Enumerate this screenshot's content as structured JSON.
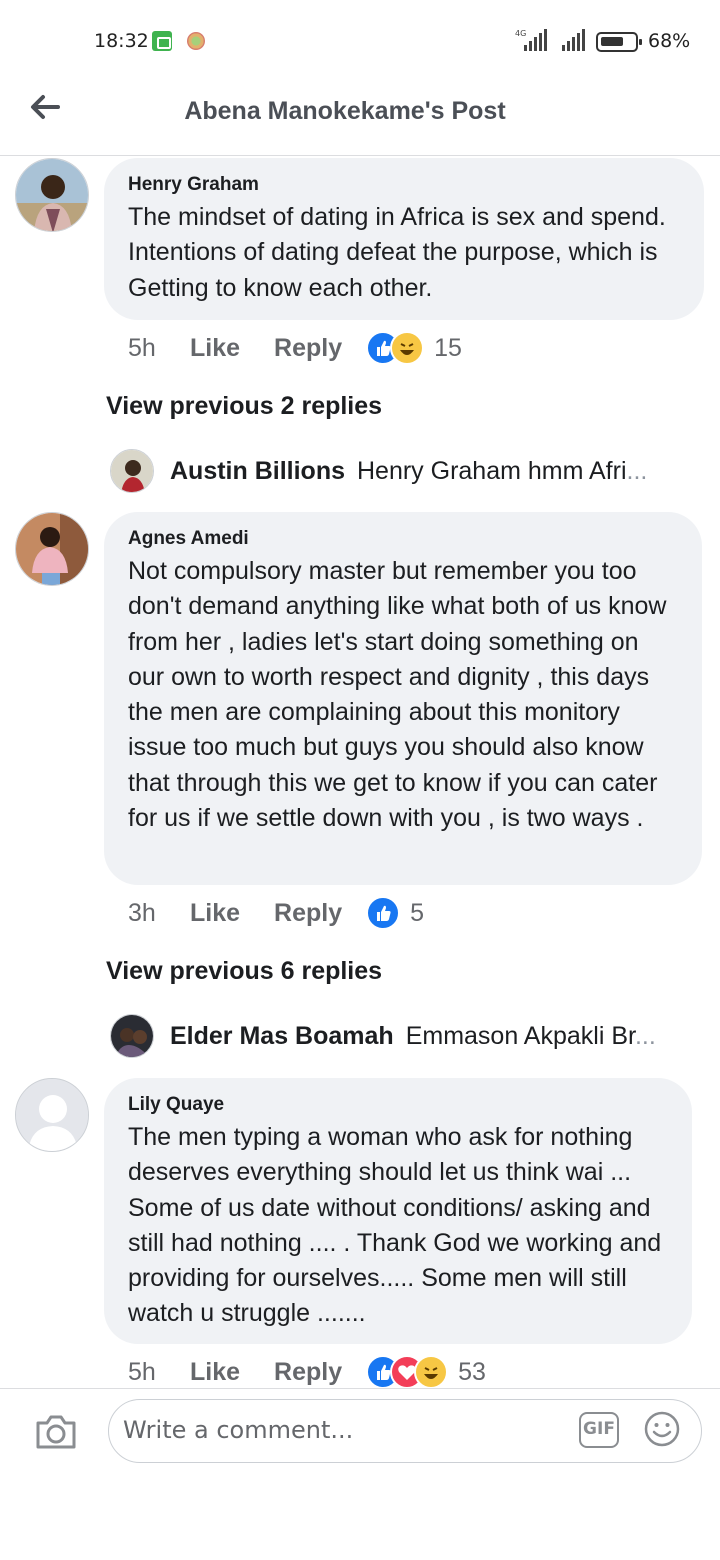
{
  "status_bar": {
    "time": "18:32",
    "network": "4G",
    "battery_pct": "68%",
    "battery_level": 0.68
  },
  "header": {
    "title": "Abena Manokekame's Post",
    "back_icon": "arrow-left-icon"
  },
  "comments": [
    {
      "name": "Henry Graham",
      "text": "The mindset of dating in Africa is sex and spend. Intentions of dating defeat the purpose, which is Getting to know each other.",
      "time": "5h",
      "like": "Like",
      "reply": "Reply",
      "reactions": [
        "like",
        "haha"
      ],
      "count": "15"
    },
    {
      "name": "Agnes Amedi",
      "text": "Not compulsory master but remember you too don't demand anything like what both of us know from her , ladies let's start doing something on our own to worth respect and dignity , this days the men are complaining about this monitory issue too much but guys you should also know that through this we get to know if you can cater for us if we settle down with you , is two ways .",
      "time": "3h",
      "like": "Like",
      "reply": "Reply",
      "reactions": [
        "like"
      ],
      "count": "5"
    },
    {
      "name": "Lily Quaye",
      "text": "The men typing a woman who ask for nothing deserves everything should let us think wai ... Some of us date without conditions/ asking and still had nothing .... . Thank God we working and providing for ourselves..... Some men will still watch u struggle .......",
      "time": "5h",
      "like": "Like",
      "reply": "Reply",
      "reactions": [
        "like",
        "love",
        "haha"
      ],
      "count": "53"
    }
  ],
  "view_previous": [
    "View previous 2 replies",
    "View previous 6 replies"
  ],
  "reply_previews": [
    {
      "name": "Austin Billions",
      "text": "Henry Graham hmm Afri",
      "ellipsis": "..."
    },
    {
      "name": "Elder Mas Boamah",
      "text": "Emmason Akpakli Br",
      "ellipsis": "..."
    }
  ],
  "composer": {
    "placeholder": "Write a comment...",
    "gif_label": "GIF",
    "camera_icon": "camera-icon",
    "emoji_icon": "smiley-icon"
  },
  "colors": {
    "bubble": "#f0f2f5",
    "meta_text": "#65676b",
    "like_blue": "#1877f2",
    "love_red": "#f33e58",
    "haha_yellow": "#f7c744"
  }
}
